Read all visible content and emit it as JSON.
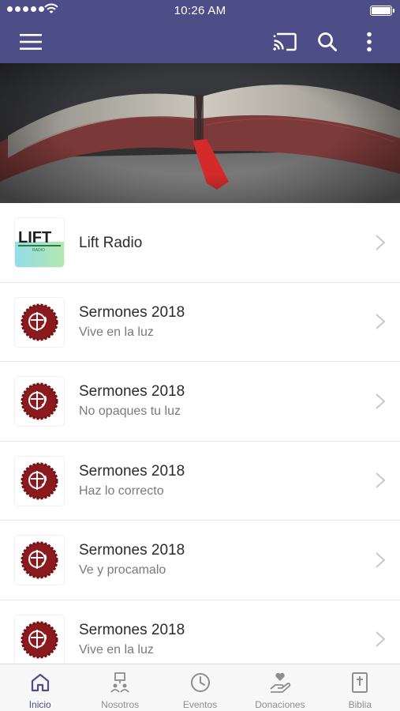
{
  "status_bar": {
    "time": "10:26 AM"
  },
  "app_bar": {
    "menu_icon": "hamburger-menu-icon",
    "cast_icon": "cast-icon",
    "search_icon": "search-icon",
    "more_icon": "more-vertical-icon"
  },
  "hero": {
    "image": "open-bible-photo"
  },
  "list": [
    {
      "title": "Lift Radio",
      "subtitle": "",
      "thumb": "lift-radio-logo"
    },
    {
      "title": "Sermones 2018",
      "subtitle": "Vive en la luz",
      "thumb": "church-seal-logo"
    },
    {
      "title": "Sermones 2018",
      "subtitle": "No opaques tu luz",
      "thumb": "church-seal-logo"
    },
    {
      "title": "Sermones 2018",
      "subtitle": "Haz lo correcto",
      "thumb": "church-seal-logo"
    },
    {
      "title": "Sermones 2018",
      "subtitle": "Ve y procamalo",
      "thumb": "church-seal-logo"
    },
    {
      "title": "Sermones 2018",
      "subtitle": "Vive en la luz",
      "thumb": "church-seal-logo"
    }
  ],
  "tabs": [
    {
      "label": "Inicio",
      "icon": "home-icon",
      "active": true
    },
    {
      "label": "Nosotros",
      "icon": "people-icon",
      "active": false
    },
    {
      "label": "Eventos",
      "icon": "clock-icon",
      "active": false
    },
    {
      "label": "Donaciones",
      "icon": "donation-hand-icon",
      "active": false
    },
    {
      "label": "Biblia",
      "icon": "bible-icon",
      "active": false
    }
  ],
  "colors": {
    "primary": "#4d4e87",
    "seal": "#8b1a1f",
    "tab_inactive": "#8e8e8e"
  }
}
